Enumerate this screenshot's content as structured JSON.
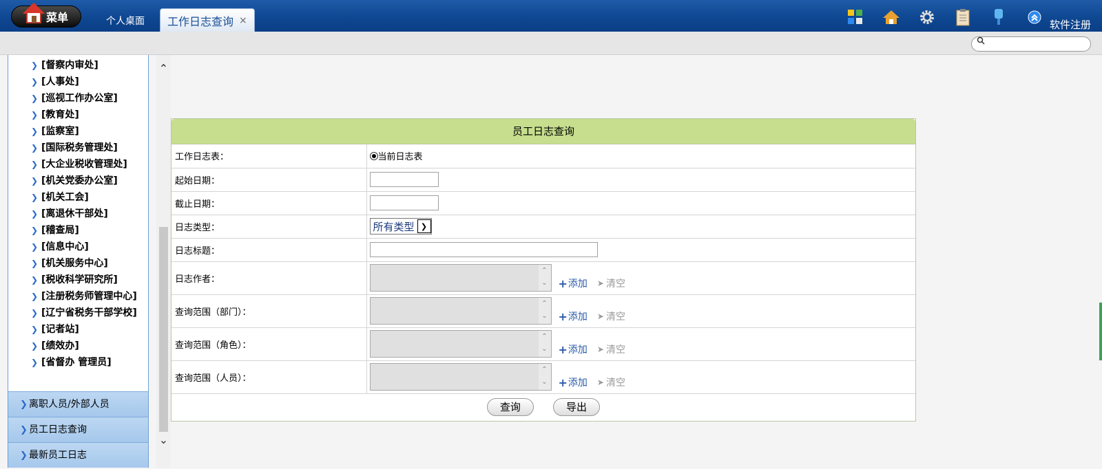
{
  "topbar": {
    "menu_label": "菜单",
    "tabs": [
      {
        "label": "个人桌面"
      },
      {
        "label": "工作日志查询",
        "close": "×"
      }
    ],
    "register_label": "软件注册",
    "icons": [
      "apps-icon",
      "home-icon",
      "gear-icon",
      "clipboard-icon",
      "key-icon",
      "collapse-icon"
    ]
  },
  "search": {
    "placeholder": ""
  },
  "sidebar": {
    "departments": [
      "[督察内审处]",
      "[人事处]",
      "[巡视工作办公室]",
      "[教育处]",
      "[监察室]",
      "[国际税务管理处]",
      "[大企业税收管理处]",
      "[机关党委办公室]",
      "[机关工会]",
      "[离退休干部处]",
      "[稽查局]",
      "[信息中心]",
      "[机关服务中心]",
      "[税收科学研究所]",
      "[注册税务师管理中心]",
      "[辽宁省税务干部学校]",
      "[记者站]",
      "[绩效办]",
      "[省督办 管理员]"
    ],
    "nav": [
      "离职人员/外部人员",
      "员工日志查询",
      "最新员工日志"
    ]
  },
  "form": {
    "title": "员工日志查询",
    "log_table_label": "工作日志表：",
    "log_table_option": "当前日志表",
    "start_date_label": "起始日期：",
    "end_date_label": "截止日期：",
    "log_type_label": "日志类型：",
    "log_type_value": "所有类型",
    "log_title_label": "日志标题：",
    "author_label": "日志作者：",
    "dept_scope_label": "查询范围（部门）：",
    "role_scope_label": "查询范围（角色）：",
    "person_scope_label": "查询范围（人员）：",
    "add_label": "添加",
    "clear_label": "清空",
    "query_button": "查询",
    "export_button": "导出"
  },
  "colors": {
    "topbar": "#0e4690",
    "panel_header": "#c6de8d",
    "nav_button": "#a6c8ec",
    "link_blue": "#2b5aa8"
  }
}
